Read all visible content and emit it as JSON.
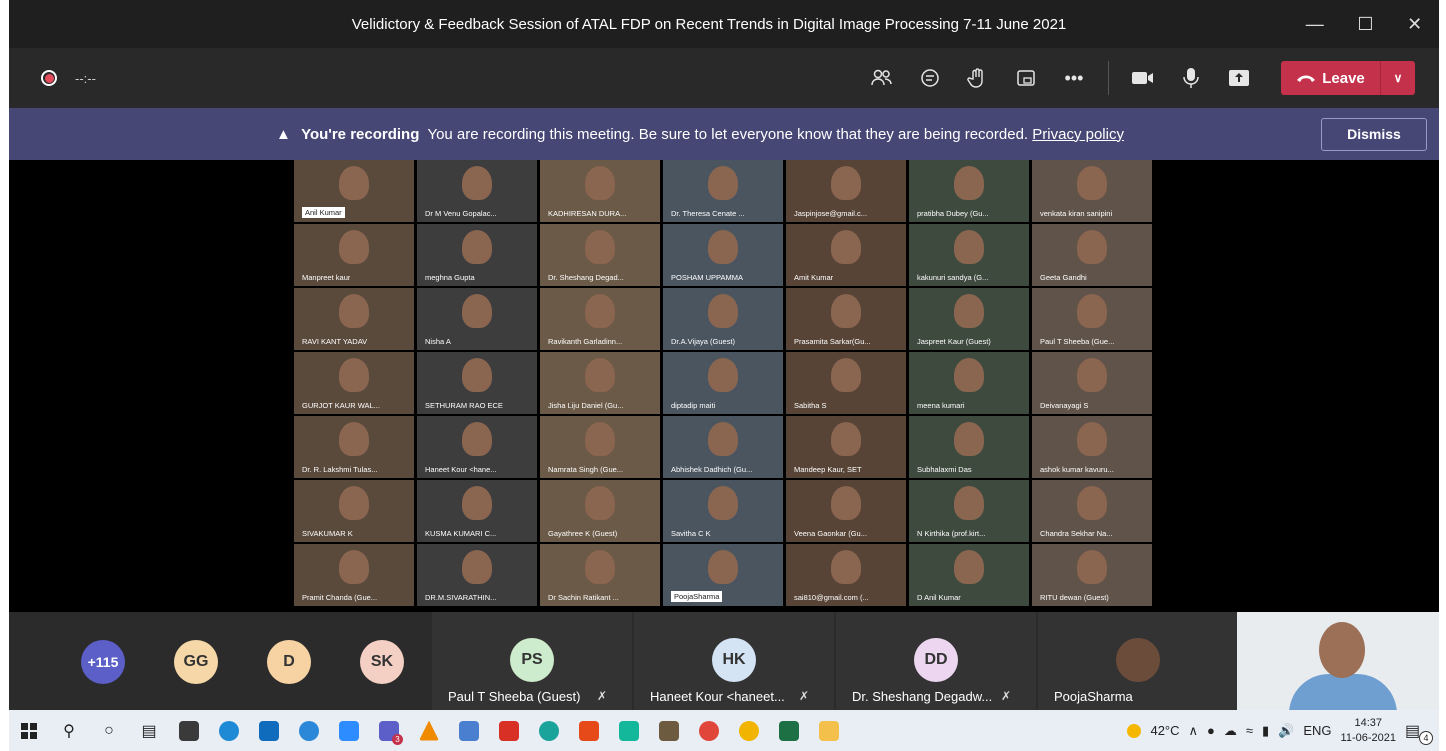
{
  "window": {
    "title": "Velidictory & Feedback Session of ATAL FDP on Recent Trends in Digital Image Processing 7-11 June 2021",
    "minimize": "—",
    "maximize": "☐",
    "close": "✕"
  },
  "toolbar": {
    "timer": "--:--",
    "leave_label": "Leave",
    "icons": [
      "people-icon",
      "chat-icon",
      "raise-hand-icon",
      "rooms-icon",
      "more-icon",
      "camera-icon",
      "mic-icon",
      "share-icon"
    ]
  },
  "banner": {
    "title": "You're recording",
    "message": "You are recording this meeting. Be sure to let everyone know that they are being recorded.",
    "link": "Privacy policy",
    "dismiss_label": "Dismiss"
  },
  "gallery": {
    "tiles": [
      "Anil Kumar",
      "Dr M Venu Gopalac...",
      "KADHIRESAN DURA...",
      "Dr. Theresa Cenate ...",
      "Jaspinjose@gmail.c...",
      "pratibha Dubey (Gu...",
      "venkata kiran sanipini",
      "Manpreet kaur",
      "meghna Gupta",
      "Dr. Sheshang Degad...",
      "POSHAM UPPAMMA",
      "Amit Kumar",
      "kakunuri sandya (G...",
      "Geeta Gandhi",
      "RAVI KANT YADAV",
      "Nisha A",
      "Ravikanth Garladinn...",
      "Dr.A.Vijaya (Guest)",
      "Prasamita Sarkar(Gu...",
      "Jaspreet Kaur (Guest)",
      "Paul T Sheeba (Gue...",
      "GURJOT KAUR WAL...",
      "SETHURAM RAO ECE",
      "Jisha Liju Daniel (Gu...",
      "diptadip maiti",
      "Sabitha S",
      "meena kumari",
      "Deivanayagi S",
      "Dr. R. Lakshmi Tulas...",
      "Haneet Kour <hane...",
      "Namrata Singh (Gue...",
      "Abhishek Dadhich (Gu...",
      "Mandeep Kaur, SET",
      "Subhalaxmi Das",
      "ashok kumar kavuru...",
      "SIVAKUMAR K",
      "KUSMA KUMARI C...",
      "Gayathree K (Guest)",
      "Savitha C K",
      "Veena Gaonkar (Gu...",
      "N Kirthika (prof.kirt...",
      "Chandra Sekhar Na...",
      "Pramit Chanda (Gue...",
      "DR.M.SIVARATHIN...",
      "Dr Sachin Ratikant ...",
      "PoojaSharma",
      "sai810@gmail.com (...",
      "D Anil Kumar",
      "RITU dewan (Guest)"
    ]
  },
  "participants": {
    "more": "+115",
    "avatars": [
      {
        "initials": "GG",
        "color": "#f5d7a8"
      },
      {
        "initials": "D",
        "color": "#f7d3a4"
      },
      {
        "initials": "SK",
        "color": "#f4cfc4"
      }
    ],
    "cards": [
      {
        "initials": "PS",
        "name": "Paul T Sheeba (Guest)",
        "color": "#cdeccd"
      },
      {
        "initials": "HK",
        "name": "Haneet Kour <haneet...",
        "color": "#d4e4f5"
      },
      {
        "initials": "DD",
        "name": "Dr. Sheshang Degadw...",
        "color": "#ecd6f0"
      },
      {
        "initials": "",
        "name": "PoojaSharma",
        "color": "#333333"
      }
    ],
    "mic_off_icon": "🎙"
  },
  "taskbar": {
    "weather": "42°C",
    "lang": "ENG",
    "time": "14:37",
    "date": "11-06-2021",
    "notifications": "4",
    "teams_badge": "3"
  }
}
